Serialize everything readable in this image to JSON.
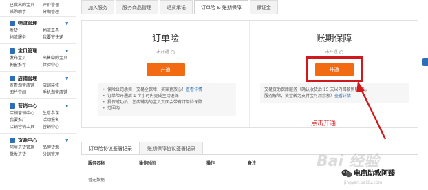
{
  "sidebar": {
    "top_rows": [
      [
        "已卖出的宝贝",
        "评价管理"
      ],
      [
        "采购助手",
        "分期管理"
      ]
    ],
    "sections": [
      {
        "title": "物流管理",
        "icon": "truck-icon",
        "rows": [
          [
            "发货",
            "物流工具"
          ],
          [
            "物流服务",
            "我要寄快递"
          ]
        ]
      },
      {
        "title": "宝贝管理",
        "icon": "box-icon",
        "rows": [
          [
            "发布宝贝",
            "出售中的宝贝"
          ],
          [
            "橱窗推荐",
            "体验中心"
          ]
        ]
      },
      {
        "title": "店铺管理",
        "icon": "store-icon",
        "rows": [
          [
            "查看淘宝店铺",
            "店铺装修"
          ],
          [
            "图片空间",
            "手机淘宝店铺"
          ]
        ]
      },
      {
        "title": "营销中心",
        "icon": "megaphone-icon",
        "rows": [
          [
            "店铺营销中心",
            "生意参谋"
          ],
          [
            "我要推广",
            "活动报名"
          ],
          [
            "店铺营销工具",
            "营销中心"
          ]
        ]
      },
      {
        "title": "货源中心",
        "icon": "supply-icon",
        "rows": [
          [
            "阿里进货管理",
            "品牌货源"
          ],
          [
            "批发进货",
            "分销管理"
          ]
        ]
      }
    ]
  },
  "tabs": [
    "加入服务",
    "服务商品管理",
    "退货承诺",
    "订单险 & 账期保障",
    "保证金"
  ],
  "active_tab": 3,
  "panel": {
    "left": {
      "title": "订单险",
      "status": "未开通",
      "button": "开通",
      "notes": [
        {
          "text": "保险公司承担，交易全保障，买家更放心！",
          "link": "查看详情"
        },
        {
          "text": "订单险开通后 1 个小时内完成主动退保",
          "link": ""
        },
        {
          "text": "投保成功后，您店铺内的宝贝页面会带有订单险保障",
          "link": ""
        },
        {
          "text": "范围内",
          "link": ""
        }
      ]
    },
    "right": {
      "title": "账期保障",
      "status": "未开通",
      "button": "开通",
      "notes": [
        {
          "text": "交易资助保障服务（确认收货后 15 天以内回款到账后），",
          "link": ""
        },
        {
          "text": "服务解除，资金转为支付宝可用余额）",
          "link": "查看详情"
        }
      ]
    }
  },
  "annotation": {
    "label": "点击开通",
    "color": "#d0191c"
  },
  "records": {
    "tabs": [
      "订单险协议签署记录",
      "账期保障协议签署记录"
    ],
    "active_tab": 0,
    "columns": [
      "服务名称",
      "操作时间",
      "操作",
      "备注"
    ],
    "empty_text": "暂无数据"
  },
  "watermark": {
    "baidu": "Bai 经验",
    "account": "电商助教阿臻",
    "sub": "jingyan.baidu.com"
  },
  "colors": {
    "accent_button": "#f26b12",
    "highlight_border": "#d0191c",
    "sidebar_icon": "#2a6fb8"
  }
}
